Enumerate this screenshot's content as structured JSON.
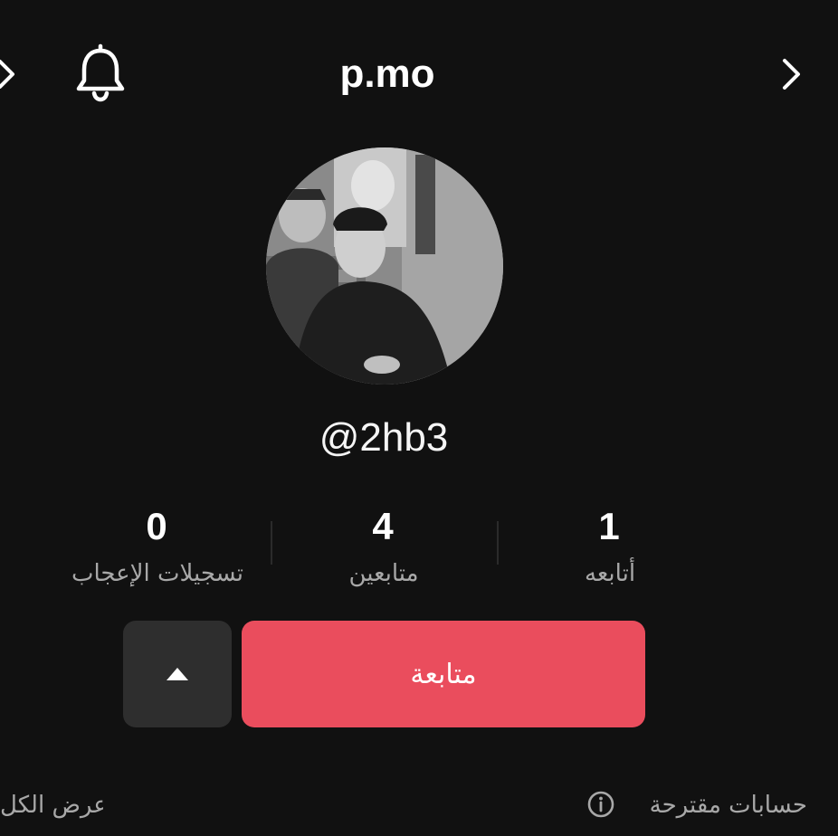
{
  "header": {
    "title": "p.mo",
    "back_icon": "chevron-left-icon",
    "notification_icon": "bell-icon",
    "forward_icon": "chevron-right-icon"
  },
  "profile": {
    "avatar": "profile-photo",
    "username": "@2hb3"
  },
  "stats": {
    "following": {
      "value": "1",
      "label": "أتابعه"
    },
    "followers": {
      "value": "4",
      "label": "متابعين"
    },
    "likes": {
      "value": "0",
      "label": "تسجيلات الإعجاب"
    }
  },
  "actions": {
    "follow_label": "متابعة",
    "more_icon": "caret-up-icon"
  },
  "suggested": {
    "label": "حسابات مقترحة",
    "info_icon": "info-icon",
    "see_all_label": "عرض الكل"
  },
  "colors": {
    "background": "#111111",
    "follow_button": "#ea4d5d",
    "secondary_button": "#2e2e2e",
    "muted_text": "#a8a8a8"
  }
}
